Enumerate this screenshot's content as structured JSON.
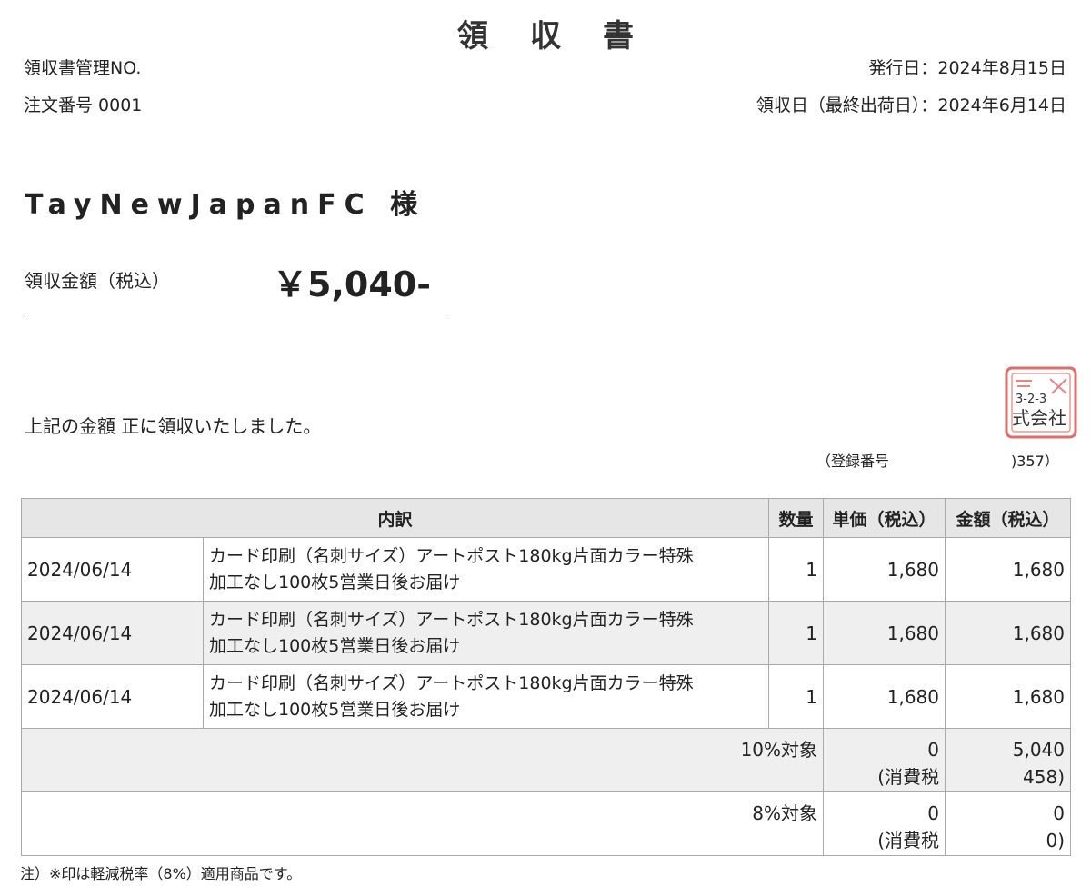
{
  "title": "領　収　書",
  "management_no": "領収書管理NO.",
  "order_no": "注文番号 0001",
  "issue_date": "発行日：2024年8月15日",
  "receipt_date": "領収日（最終出荷日）：2024年6月14日",
  "customer": "TayNewJapanFC 様",
  "amount_label": "領収金額（税込）",
  "amount_value": "￥5,040-",
  "received_text": "上記の金額 正に領収いたしました。",
  "registration_label": "（登録番号",
  "registration_tail": ")357）",
  "stamp": {
    "line1": "3-2-3",
    "line2": "式会社",
    "color": "#d9534f"
  },
  "table": {
    "headers": {
      "breakdown": "内訳",
      "qty": "数量",
      "unit_price": "単価（税込）",
      "amount": "金額（税込）"
    },
    "rows": [
      {
        "date": "2024/06/14",
        "desc_line1": "カード印刷（名刺サイズ）アートポスト180kg片面カラー特殊",
        "desc_line2": "加工なし100枚5営業日後お届け",
        "qty": "1",
        "unit_price": "1,680",
        "amount": "1,680"
      },
      {
        "date": "2024/06/14",
        "desc_line1": "カード印刷（名刺サイズ）アートポスト180kg片面カラー特殊",
        "desc_line2": "加工なし100枚5営業日後お届け",
        "qty": "1",
        "unit_price": "1,680",
        "amount": "1,680"
      },
      {
        "date": "2024/06/14",
        "desc_line1": "カード印刷（名刺サイズ）アートポスト180kg片面カラー特殊",
        "desc_line2": "加工なし100枚5営業日後お届け",
        "qty": "1",
        "unit_price": "1,680",
        "amount": "1,680"
      }
    ],
    "tax_10": {
      "label": "10%対象",
      "base": "0",
      "tax_label": "(消費税",
      "total": "5,040",
      "tax": "458)"
    },
    "tax_8": {
      "label": "8%対象",
      "base": "0",
      "tax_label": "(消費税",
      "total": "0",
      "tax": "0)"
    }
  },
  "footnote": "注）※印は軽減税率（8%）適用商品です。"
}
